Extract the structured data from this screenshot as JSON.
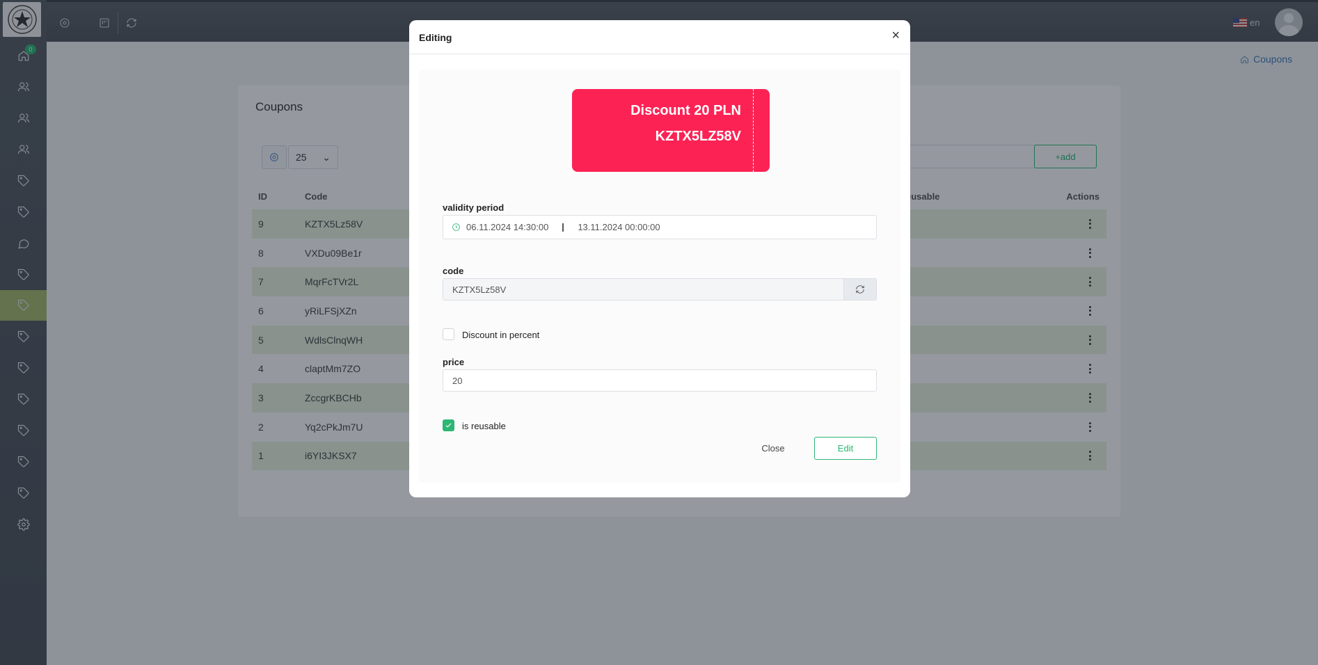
{
  "sidebar": {
    "home_badge": "0",
    "items": [
      {
        "icon": "home-icon"
      },
      {
        "icon": "users-icon"
      },
      {
        "icon": "users-icon"
      },
      {
        "icon": "users-icon"
      },
      {
        "icon": "tag-icon"
      },
      {
        "icon": "tag-icon"
      },
      {
        "icon": "chat-icon"
      },
      {
        "icon": "tag-icon"
      },
      {
        "icon": "tag-icon",
        "active": true
      },
      {
        "icon": "tag-icon"
      },
      {
        "icon": "tag-icon"
      },
      {
        "icon": "tag-icon"
      },
      {
        "icon": "tag-icon"
      },
      {
        "icon": "tag-icon"
      },
      {
        "icon": "tag-icon"
      },
      {
        "icon": "gear-icon"
      }
    ]
  },
  "header": {
    "language": "en"
  },
  "breadcrumb": {
    "label": "Coupons"
  },
  "page": {
    "title": "Coupons",
    "page_size": "25",
    "add_label": "+add",
    "columns": {
      "id": "ID",
      "code": "Code",
      "reusable": "eusable",
      "actions": "Actions"
    },
    "rows": [
      {
        "id": "9",
        "code": "KZTX5Lz58V"
      },
      {
        "id": "8",
        "code": "VXDu09Be1r"
      },
      {
        "id": "7",
        "code": "MqrFcTVr2L"
      },
      {
        "id": "6",
        "code": "yRiLFSjXZn"
      },
      {
        "id": "5",
        "code": "WdlsClnqWH"
      },
      {
        "id": "4",
        "code": "claptMm7ZO"
      },
      {
        "id": "3",
        "code": "ZccgrKBCHb"
      },
      {
        "id": "2",
        "code": "Yq2cPkJm7U"
      },
      {
        "id": "1",
        "code": "i6YI3JKSX7"
      }
    ]
  },
  "modal": {
    "title": "Editing",
    "close_symbol": "×",
    "coupon": {
      "title": "Discount 20 PLN",
      "code": "KZTX5LZ58V"
    },
    "validity_label": "validity period",
    "validity_start": "06.11.2024 14:30:00",
    "validity_end": "13.11.2024 00:00:00",
    "code_label": "code",
    "code_value": "KZTX5Lz58V",
    "discount_percent_label": "Discount in percent",
    "discount_percent_checked": false,
    "price_label": "price",
    "price_value": "20",
    "reusable_label": "is reusable",
    "reusable_checked": true,
    "close_button": "Close",
    "edit_button": "Edit"
  },
  "colors": {
    "accent_green": "#2bb673",
    "coupon_red": "#fd2254",
    "active_nav": "#a7b86b",
    "row_stripe": "#eaf3de"
  }
}
